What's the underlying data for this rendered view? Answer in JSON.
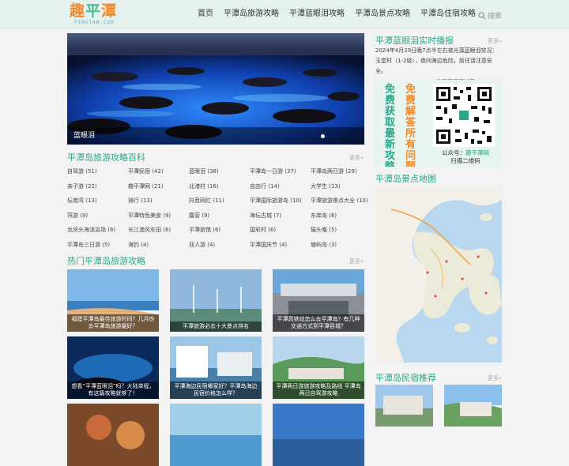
{
  "logo": {
    "text1": "趣",
    "text2": "平",
    "text3": "潭",
    "sub": "PINGTAN.COM"
  },
  "nav": [
    "首页",
    "平潭岛旅游攻略",
    "平潭蓝眼泪攻略",
    "平潭岛景点攻略",
    "平潭岛住宿攻略"
  ],
  "search": {
    "label": "搜索"
  },
  "banner": {
    "caption": "蓝眼泪"
  },
  "wiki": {
    "title": "平潭岛旅游攻略百科",
    "more": "更多»",
    "items": [
      "自驾游 (51)",
      "平潭民宿 (42)",
      "蓝眼泪 (38)",
      "平潭岛一日游 (37)",
      "平潭岛两日游 (29)",
      "亲子游 (22)",
      "趣平潭网 (21)",
      "北港村 (16)",
      "自由行 (14)",
      "大学生 (13)",
      "坛南湾 (13)",
      "骑行 (13)",
      "抖音网红 (11)",
      "平潭国际旅游岛 (10)",
      "平潭旅游景点大全 (10)",
      "窍游 (9)",
      "平潭特色美食 (9)",
      "露营 (9)",
      "海坛古城 (7)",
      "东庠岛 (6)",
      "龙凤头海滨浴场 (6)",
      "长江澳风车田 (6)",
      "平潭旅馆 (6)",
      "国彩村 (6)",
      "猫头墘 (5)",
      "平潭岛三日游 (5)",
      "海钓 (4)",
      "双人游 (4)",
      "平潭国庆节 (4)",
      "塘屿岛 (3)"
    ]
  },
  "hot": {
    "title": "热门平潭岛旅游攻略",
    "more": "更多»",
    "cards": [
      "福建平潭岛最佳旅游时间？几月份去平潭岛旅游最好？",
      "平潭旅游必去十大景点排名",
      "平潭高铁站怎么去平潭岛？有几种交通方式到平潭县城？",
      "想看“平潭蓝眼泪”吗？大陆单程，有这篇攻略就够了！",
      "平潭海边民宿哪家好？平潭岛海边民宿价格怎么样？",
      "平潭两日游旅游攻略及路线 平潭岛两日自驾游攻略",
      "",
      "",
      ""
    ]
  },
  "live": {
    "title": "平潭蓝眼泪实时播报",
    "more": "更多»",
    "text": "2024年4月29日晚7点半左右夜光藻蓝眼泪实况：玉堂村（1-2级），夜间海边危险，前往请注意安全。",
    "by": "——趣平潭网更新于（19:46）"
  },
  "qr": {
    "v1": "免费获取最新攻略",
    "v2": "免费解答所有问题",
    "line1": "公众号：",
    "line1_hl": "趣平潭网",
    "line2": "扫描二维码"
  },
  "mapsec": {
    "title": "平潭岛景点地图"
  },
  "innsec": {
    "title": "平潭岛民宿推荐",
    "more": "更多»"
  },
  "colors": {
    "accent": "#2aa889",
    "logo_orange": "#f08a2c",
    "topbar": "#e4f1ef"
  }
}
